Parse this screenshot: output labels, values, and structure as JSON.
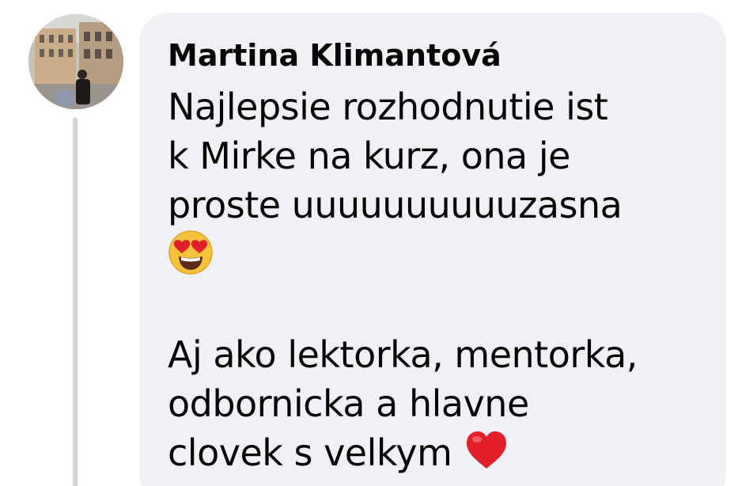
{
  "comment": {
    "author": "Martina Klimantová",
    "paragraph1": {
      "line1": "Najlepsie rozhodnutie ist",
      "line2": "k Mirke na kurz, ona je",
      "line3": "proste uuuuuuuuuuzasna"
    },
    "paragraph2": {
      "line1": "Aj ako lektorka, mentorka,",
      "line2": "odbornicka a hlavne",
      "line3": "clovek s velkym"
    },
    "emojis": {
      "first": "smiling-face-with-heart-eyes",
      "second": "red-heart"
    }
  },
  "colors": {
    "bubble_background": "#f0f1f5",
    "text": "#050505",
    "thread_line": "#d2d4d9",
    "emoji_yellow": "#f7c23b",
    "heart_red": "#e21f2b"
  }
}
